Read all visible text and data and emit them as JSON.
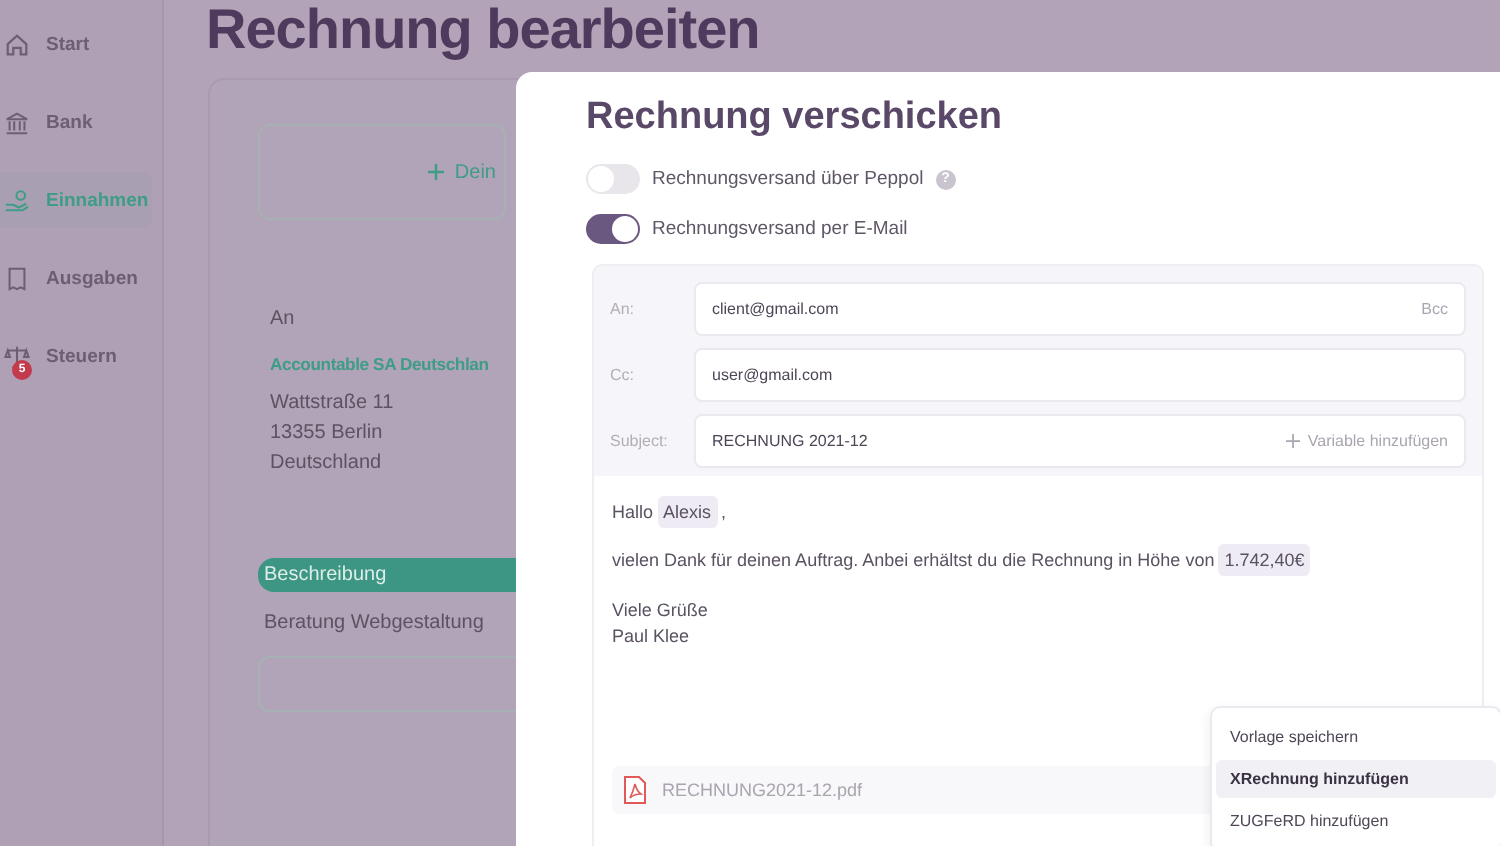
{
  "sidebar": {
    "items": [
      {
        "label": "Start",
        "kind": "home",
        "selected": false
      },
      {
        "label": "Bank",
        "kind": "bank",
        "selected": false
      },
      {
        "label": "Einnahmen",
        "kind": "income",
        "selected": true
      },
      {
        "label": "Ausgaben",
        "kind": "receipt",
        "selected": false
      },
      {
        "label": "Steuern",
        "kind": "scale",
        "selected": false,
        "badge": "5"
      }
    ]
  },
  "page": {
    "title": "Rechnung bearbeiten"
  },
  "invoice": {
    "add_logo": "Dein",
    "recipient_label": "An",
    "company": "Accountable SA Deutschlan",
    "address": [
      "Wattstraße 11",
      "13355 Berlin",
      "Deutschland"
    ],
    "description_header": "Beschreibung",
    "description": "Beratung Webgestaltung"
  },
  "dialog": {
    "title": "Rechnung verschicken",
    "toggles": [
      {
        "label": "Rechnungsversand über Peppol",
        "on": false,
        "help": "?"
      },
      {
        "label": "Rechnungsversand per E-Mail",
        "on": true
      }
    ],
    "fields": [
      {
        "label": "An:",
        "value": "client@gmail.com",
        "action": {
          "text": "Bcc",
          "kind": "text"
        }
      },
      {
        "label": "Cc:",
        "value": "user@gmail.com"
      },
      {
        "label": "Subject:",
        "value": "RECHNUNG 2021-12",
        "action": {
          "text": "Variable hinzufügen",
          "kind": "add"
        }
      }
    ],
    "body": {
      "greeting": "Hallo",
      "name": "Alexis",
      "greeting_end": ",",
      "text": "vielen Dank für deinen Auftrag. Anbei erhältst du die Rechnung in Höhe von",
      "amount": "1.742,40€",
      "closing": [
        "Viele Grüße",
        "Paul Klee"
      ]
    },
    "attachment": "RECHNUNG2021-12.pdf",
    "menu": [
      {
        "label": "Vorlage speichern",
        "selected": false
      },
      {
        "label": "XRechnung hinzufügen",
        "selected": true
      },
      {
        "label": "ZUGFeRD hinzufügen",
        "selected": false
      }
    ]
  }
}
